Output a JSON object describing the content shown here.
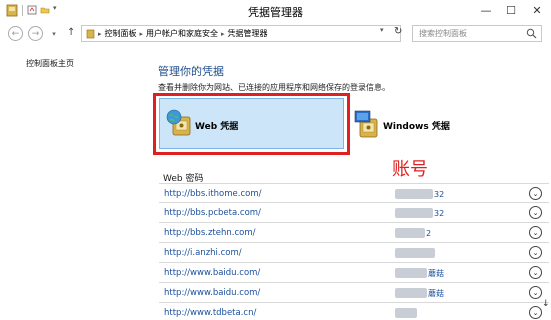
{
  "window": {
    "title": "凭据管理器",
    "minimize": "—",
    "maximize": "☐",
    "close": "✕"
  },
  "address": {
    "back": "←",
    "forward": "→",
    "up": "↑",
    "crumbs": [
      "控制面板",
      "用户帐户和家庭安全",
      "凭据管理器"
    ],
    "separator": "▸",
    "dropdown": "▾",
    "refresh": "↻",
    "search_placeholder": "搜索控制面板"
  },
  "leftnav": {
    "home_link": "控制面板主页"
  },
  "main": {
    "heading": "管理你的凭据",
    "description": "查看并删除你为网站、已连接的应用程序和网络保存的登录信息。",
    "web_credentials_label": "Web 凭据",
    "windows_credentials_label": "Windows 凭据",
    "annotation": "账号",
    "section_title": "Web 密码",
    "rows": [
      {
        "url": "http://bbs.ithome.com/",
        "user_tail": "32",
        "blur_width": 38
      },
      {
        "url": "http://bbs.pcbeta.com/",
        "user_tail": "32",
        "blur_width": 38
      },
      {
        "url": "http://bbs.ztehn.com/",
        "user_tail": "2",
        "blur_width": 30
      },
      {
        "url": "http://i.anzhi.com/",
        "user_tail": "",
        "blur_width": 40
      },
      {
        "url": "http://www.baidu.com/",
        "user_tail": "蘑菇",
        "blur_width": 32
      },
      {
        "url": "http://www.baidu.com/",
        "user_tail": "蘑菇",
        "blur_width": 32
      },
      {
        "url": "http://www.tdbeta.cn/",
        "user_tail": "",
        "blur_width": 22
      }
    ],
    "expand_glyph": "⌄",
    "scroll_down": "↓"
  }
}
